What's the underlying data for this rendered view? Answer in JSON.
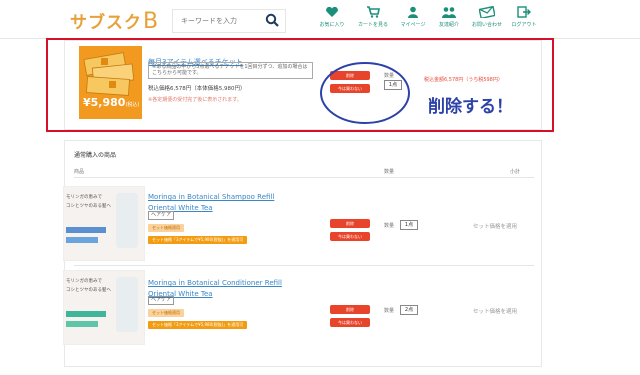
{
  "header": {
    "logo_text": "サブスク",
    "logo_b": "B",
    "search_placeholder": "キーワードを入力",
    "nav": [
      {
        "label": "お気に入り",
        "icon": "heart-icon"
      },
      {
        "label": "カートを見る",
        "icon": "cart-icon"
      },
      {
        "label": "マイページ",
        "icon": "person-icon"
      },
      {
        "label": "友達紹介",
        "icon": "people-icon"
      },
      {
        "label": "お問い合わせ",
        "icon": "mail-icon"
      },
      {
        "label": "ログアウト",
        "icon": "logout-icon"
      }
    ]
  },
  "ticket": {
    "title": "毎月3アイテム選べるチケット",
    "description": "※ある商品の中から3点選べるチケットを1回目分ずつ、追加の場合はこちらから可能です。",
    "price_badge": "¥5,980",
    "price_badge_suffix": "(税込)",
    "price_label": "税込価格6,578円（本体価格5,980円）",
    "note": "※各定期便の受付完了後に表示されます。",
    "qty_label": "数量",
    "qty_value": "1点",
    "delete_label": "削除",
    "later_label": "今は買わない",
    "tax_text": "税込金額6,578円（うち税598円）",
    "annotation": "削除する！"
  },
  "regular": {
    "section_title": "通常購入の商品",
    "col_product": "商品",
    "col_qty": "数量",
    "col_subtotal": "小計",
    "items": [
      {
        "name": "Moringa in Botanical Shampoo Refill Oriental White Tea",
        "category": "ヘアケア",
        "qty_label": "数量",
        "qty_value": "1点",
        "delete_label": "削除",
        "later_label": "今は買わない",
        "price_link": "セット価格を適用",
        "pill_light": "セット価格適用",
        "pill_main": "セット価格「3アイテムで¥5,980(税抜)」を適用可",
        "thumb_line1": "モリンガの恵みで",
        "thumb_line2": "コシとツヤのある髪へ"
      },
      {
        "name": "Moringa in Botanical Conditioner Refill Oriental White Tea",
        "category": "ヘアケア",
        "qty_label": "数量",
        "qty_value": "2点",
        "delete_label": "削除",
        "later_label": "今は買わない",
        "price_link": "セット価格を適用",
        "pill_light": "セット価格適用",
        "pill_main": "セット価格「3アイテムで¥5,980(税抜)」を適用可",
        "thumb_line1": "モリンガの恵みで",
        "thumb_line2": "コシとツヤのある髪へ"
      }
    ]
  },
  "colors": {
    "brand": "#e8a13a",
    "accent_teal": "#1a8f7a",
    "highlight_red": "#d7102a",
    "annotation_blue": "#2d42a9"
  }
}
